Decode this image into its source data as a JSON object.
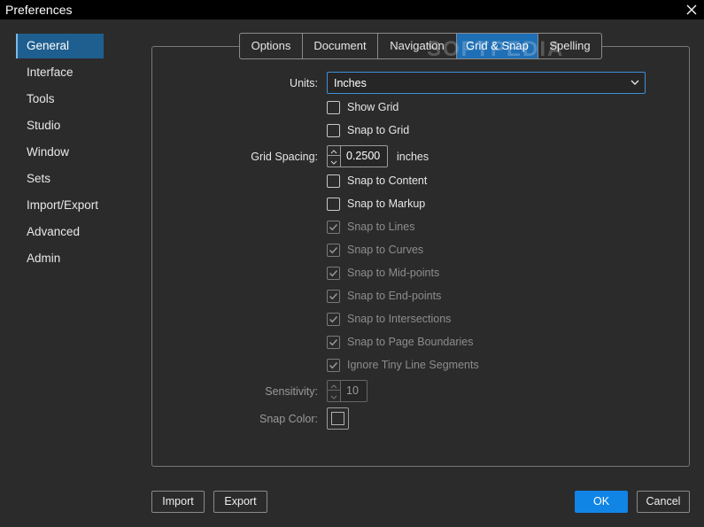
{
  "window": {
    "title": "Preferences"
  },
  "sidebar": {
    "items": [
      {
        "label": "General",
        "active": true
      },
      {
        "label": "Interface"
      },
      {
        "label": "Tools"
      },
      {
        "label": "Studio"
      },
      {
        "label": "Window"
      },
      {
        "label": "Sets"
      },
      {
        "label": "Import/Export"
      },
      {
        "label": "Advanced"
      },
      {
        "label": "Admin"
      }
    ]
  },
  "tabs": [
    {
      "label": "Options"
    },
    {
      "label": "Document"
    },
    {
      "label": "Navigation"
    },
    {
      "label": "Grid & Snap",
      "active": true
    },
    {
      "label": "Spelling"
    }
  ],
  "watermark": "SOFTPEDIA",
  "form": {
    "units_label": "Units:",
    "units_value": "Inches",
    "grid_spacing_label": "Grid Spacing:",
    "grid_spacing_value": "0.2500",
    "grid_spacing_unit": "inches",
    "sensitivity_label": "Sensitivity:",
    "sensitivity_value": "10",
    "snap_color_label": "Snap Color:",
    "checkboxes": [
      {
        "label": "Show Grid",
        "checked": false,
        "enabled": true
      },
      {
        "label": "Snap to Grid",
        "checked": false,
        "enabled": true
      },
      {
        "label": "Snap to Content",
        "checked": false,
        "enabled": true
      },
      {
        "label": "Snap to Markup",
        "checked": false,
        "enabled": true
      },
      {
        "label": "Snap to Lines",
        "checked": true,
        "enabled": false
      },
      {
        "label": "Snap to Curves",
        "checked": true,
        "enabled": false
      },
      {
        "label": "Snap to Mid-points",
        "checked": true,
        "enabled": false
      },
      {
        "label": "Snap to End-points",
        "checked": true,
        "enabled": false
      },
      {
        "label": "Snap to Intersections",
        "checked": true,
        "enabled": false
      },
      {
        "label": "Snap to Page Boundaries",
        "checked": true,
        "enabled": false
      },
      {
        "label": "Ignore Tiny Line Segments",
        "checked": true,
        "enabled": false
      }
    ]
  },
  "footer": {
    "import_label": "Import",
    "export_label": "Export",
    "ok_label": "OK",
    "cancel_label": "Cancel"
  },
  "colors": {
    "accent": "#1185e6",
    "tab_active": "#1e6fb5",
    "sidebar_active": "#1f5f8f",
    "background": "#2b2b2b"
  },
  "icons": {
    "close": "close-icon",
    "dropdown": "chevron-down-icon",
    "spin_up": "chevron-up-icon",
    "spin_down": "chevron-down-icon",
    "check": "check-icon"
  }
}
